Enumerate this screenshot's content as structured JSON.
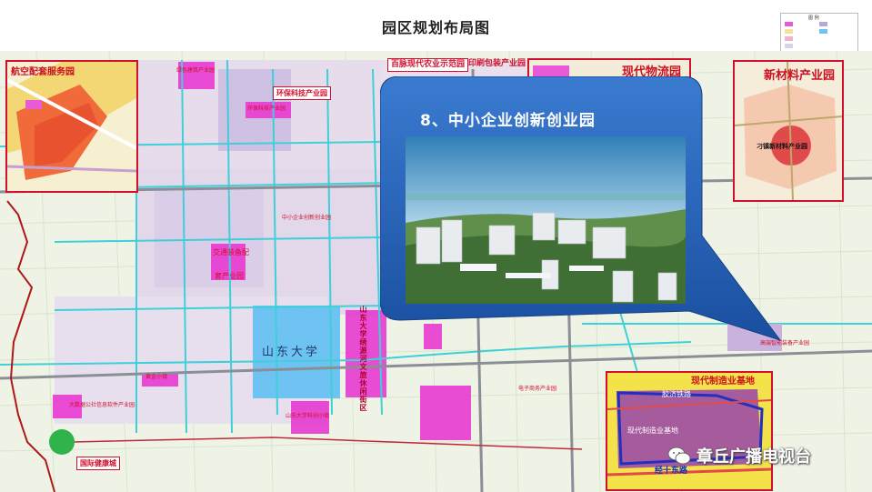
{
  "page": {
    "title": "园区规划布局图"
  },
  "legend": {
    "title": "图 例"
  },
  "callout": {
    "title": "8、中小企业创新创业园"
  },
  "insets": {
    "aviation": {
      "label": "航空配套服务园"
    },
    "logistics": {
      "label": "现代物流园"
    },
    "new_materials": {
      "label": "新材料产业园",
      "inner_label": "刁镇新材料产业园"
    },
    "manufacturing": {
      "label": "现代制造业基地",
      "inner_label": "现代制造业基地",
      "rail_label": "胶济铁路",
      "road_label": "经十东路"
    }
  },
  "park_labels": {
    "agri_demo": "百脉现代农业示范园",
    "printing": "印刷包装产业园",
    "eco_tech": "环保科技产业园",
    "green_build": "绿色建筑产业园",
    "green_tech_small": "环保科技产业园",
    "transport_equip_l1": "交通装备配",
    "transport_equip_l2": "套产业园",
    "bigdata": "大数据公社信息软件产业园",
    "gold_town": "黄金小镇",
    "sdu_town": "山东大学科创小镇",
    "sdu": "山东大学",
    "culture_street": "山东大学绣源河文旅休闲街区",
    "intl_health": "国际健康城",
    "sme_small": "中小企业创新创业园",
    "smart_small": "高端智能装备产业园",
    "ecom_small": "电子商务产业园"
  },
  "watermark": {
    "text": "章丘广播电视台",
    "icon": "wechat-icon"
  },
  "colors": {
    "callout_fill": "#1f5fb0",
    "label_red": "#d0102c",
    "zone_magenta": "#e83ad0",
    "zone_purple": "#b9a6d4",
    "zone_blue": "#6fc3f2",
    "road_cyan": "#3ed0d8",
    "boundary_red": "#b01818",
    "farmland_green": "#d6e8c2"
  }
}
